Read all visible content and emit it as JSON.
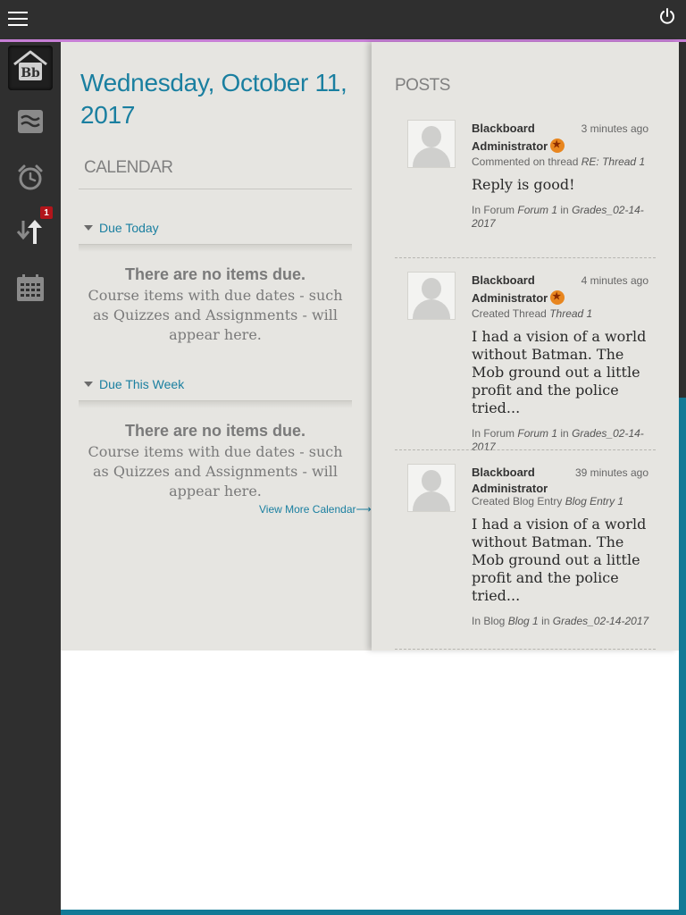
{
  "header": {
    "menu_icon": "hamburger-icon",
    "power_icon": "power-icon"
  },
  "sidebar": {
    "items": [
      {
        "icon": "blackboard-home-icon",
        "label": "Bb",
        "active": true
      },
      {
        "icon": "streams-icon"
      },
      {
        "icon": "alarm-clock-icon"
      },
      {
        "icon": "grades-updown-icon",
        "badge": "1"
      },
      {
        "icon": "calendar-icon"
      }
    ]
  },
  "calendar": {
    "date": "Wednesday, October 11, 2017",
    "heading": "CALENDAR",
    "sections": [
      {
        "label": "Due Today",
        "empty_title": "There are no items due.",
        "empty_text": "Course items with due dates - such as Quizzes and Assignments - will appear here."
      },
      {
        "label": "Due This Week",
        "empty_title": "There are no items due.",
        "empty_text": "Course items with due dates - such as Quizzes and Assignments - will appear here."
      }
    ],
    "view_more": "View More Calendar⟶"
  },
  "posts": {
    "heading": "POSTS",
    "items": [
      {
        "author_first": "Blackboard",
        "author_second": "Administrator",
        "time": "3 minutes ago",
        "action_prefix": "Commented on thread",
        "action_target": "RE: Thread 1",
        "content": "Reply is good!",
        "location_prefix": "In Forum",
        "location_name": "Forum 1",
        "location_in": "in",
        "course": "Grades_02-14-2017"
      },
      {
        "author_first": "Blackboard",
        "author_second": "Administrator",
        "time": "4 minutes ago",
        "action_prefix": "Created Thread",
        "action_target": "Thread 1",
        "content": "I had a vision of a world without Batman. The Mob ground out a little profit and the police tried...",
        "location_prefix": "In Forum",
        "location_name": "Forum 1",
        "location_in": "in",
        "course": "Grades_02-14-2017"
      },
      {
        "author_first": "Blackboard",
        "author_second": "Administrator",
        "time": "39 minutes ago",
        "action_prefix": "Created Blog Entry",
        "action_target": "Blog Entry 1",
        "content": "I had a vision of a world without Batman. The Mob ground out a little profit and the police tried...",
        "location_prefix": "In Blog",
        "location_name": "Blog 1",
        "location_in": "in",
        "course": "Grades_02-14-2017"
      }
    ]
  },
  "colors": {
    "accent": "#1a7fa0",
    "topbar_line": "#c77fd6",
    "badge": "#b2151b",
    "panel": "#e6e5e1"
  }
}
